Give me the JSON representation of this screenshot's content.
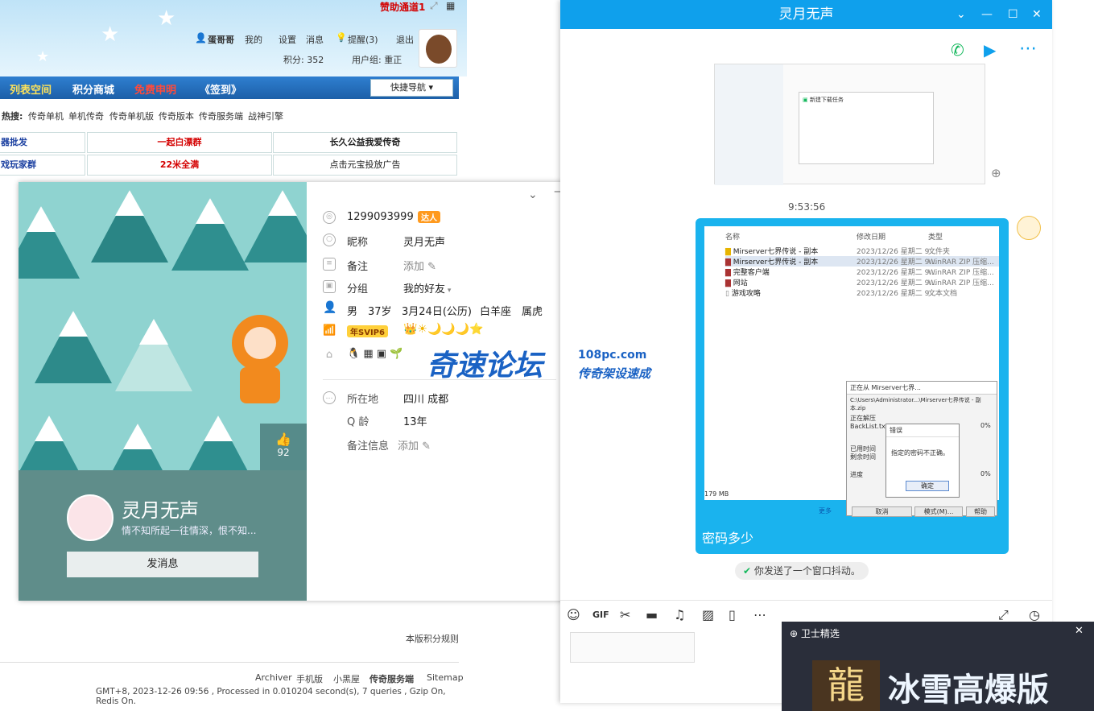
{
  "forum": {
    "sponsor": "赞助通道1",
    "user": {
      "name": "蛋哥哥",
      "mine": "我的",
      "settings": "设置",
      "messages": "消息",
      "reminder": "提醒(3)",
      "logout": "退出",
      "points": "积分: 352",
      "group": "用户组: 重正"
    },
    "nav": [
      "列表空间",
      "积分商城",
      "免费申明",
      "《签到》"
    ],
    "quick_nav": "快捷导航",
    "hot_label": "热搜:",
    "hot_items": [
      "传奇单机",
      "单机传奇",
      "传奇单机版",
      "传奇版本",
      "传奇服务端",
      "战神引擎"
    ],
    "cells_row1": [
      "器批发",
      "一起白漂群",
      "长久公益我爱传奇"
    ],
    "cells_row2": [
      "戏玩家群",
      "22米全满",
      "点击元宝投放广告"
    ],
    "points_rule": "本版积分规则",
    "footer_links": [
      "Archiver",
      "手机版",
      "小黑屋",
      "传奇服务端",
      "Sitemap"
    ],
    "footer_info": "GMT+8, 2023-12-26 09:56 , Processed in 0.010204 second(s), 7 queries , Gzip On, Redis On."
  },
  "profile": {
    "qq": "1299093999",
    "qq_badge": "达人",
    "nickname_label": "昵称",
    "nickname": "灵月无声",
    "remark_label": "备注",
    "remark_action": "添加",
    "group_label": "分组",
    "group": "我的好友",
    "gender": "男",
    "age": "37岁",
    "birthday": "3月24日(公历)",
    "zodiac": "白羊座",
    "chinese_zodiac": "属虎",
    "vip": "年SVIP6",
    "location_label": "所在地",
    "location": "四川 成都",
    "qage_label": "Q 龄",
    "qage": "13年",
    "remark_info_label": "备注信息",
    "remark_info_action": "添加",
    "likes": "92",
    "display_name": "灵月无声",
    "signature": "情不知所起一往情深，恨不知...",
    "message_button": "发消息"
  },
  "chat": {
    "title": "灵月无声",
    "timestamp": "9:53:56",
    "files": [
      {
        "name": "Mirserver七界传说 - 副本",
        "date": "2023/12/26 星期二 9...",
        "type": "文件夹"
      },
      {
        "name": "Mirserver七界传说 - 副本",
        "date": "2023/12/26 星期二 9...",
        "type": "WinRAR ZIP 压缩..."
      },
      {
        "name": "完整客户端",
        "date": "2023/12/26 星期二 9...",
        "type": "WinRAR ZIP 压缩..."
      },
      {
        "name": "网站",
        "date": "2023/12/26 星期二 9...",
        "type": "WinRAR ZIP 压缩..."
      },
      {
        "name": "游戏攻略",
        "date": "2023/12/26 星期二 9...",
        "type": "文本文档"
      }
    ],
    "file_headers": [
      "名称",
      "修改日期",
      "类型"
    ],
    "extract_title": "正在从 Mirserver七界...",
    "extract_path": "C:\\Users\\Administrator...\\Mirserver七界传说 - 副本.zip",
    "extract_status": "正在解压",
    "extract_file": "BackList.txt",
    "elapsed": "已用时间",
    "remaining": "剩余时间",
    "progress": "进度",
    "percent": "0%",
    "error_title": "错误",
    "error_msg": "指定的密码不正确。",
    "ok": "确定",
    "cancel": "取消",
    "mode": "模式(M)...",
    "help": "帮助",
    "size": "179 MB",
    "more": "更多",
    "message_text": "密码多少",
    "shake_notice": "你发送了一个窗口抖动。",
    "dl_dialog_title": "新建下载任务"
  },
  "watermark": {
    "brand": "奇速论坛",
    "domain": "108pc.com",
    "slogan": "传奇架设速成"
  },
  "ad": {
    "label": "卫士精选",
    "title": "冰雪高爆版",
    "glyph": "龍"
  }
}
